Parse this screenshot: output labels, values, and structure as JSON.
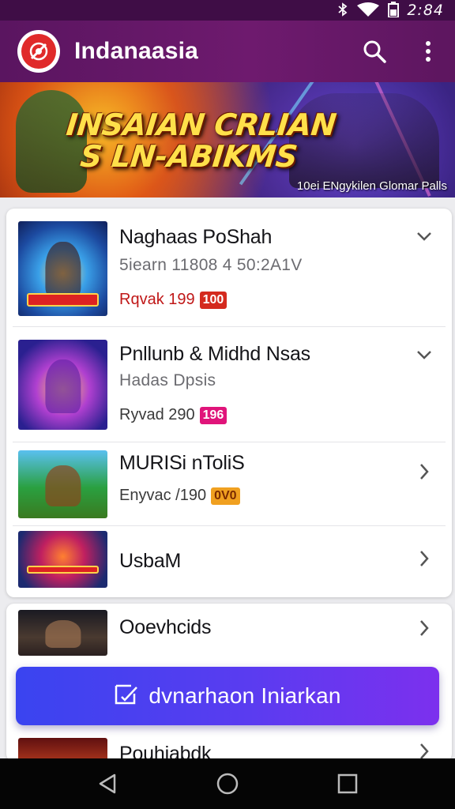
{
  "status_bar": {
    "time": "2:84",
    "icons": [
      "bluetooth-icon",
      "wifi-icon",
      "battery-icon"
    ]
  },
  "app_bar": {
    "title": "Indanaasia",
    "actions": [
      "search-icon",
      "more-vert-icon"
    ]
  },
  "banner": {
    "headline_line1": "INSAIAN CRLIAN",
    "headline_line2": "S LN-ABIKMS",
    "caption": "10ei ENgykilen Glomar Palls"
  },
  "list": {
    "items": [
      {
        "title": "Naghaas PoShah",
        "subtitle": "5iearn 11808 4 50:2A1V",
        "meta_text": "Rqvak 199",
        "badge": "100",
        "badge_color": "#d42a1e",
        "meta_color": "#c01818",
        "chevron": "chevron-down-icon"
      },
      {
        "title": "Pnllunb & Midhd Nsas",
        "subtitle": "Hadas Dpsis",
        "meta_text": "Ryvad 290",
        "badge": "196",
        "badge_color": "#e0147a",
        "meta_color": "#3a3a3a",
        "chevron": "chevron-down-icon"
      },
      {
        "title": "MURISi nToliS",
        "subtitle": "",
        "meta_text": "Enyvac /190",
        "badge": "0V0",
        "badge_color": "#f0a020",
        "meta_color": "#3a3a3a",
        "chevron": "chevron-right-icon"
      },
      {
        "title": "UsbaM",
        "subtitle": "",
        "meta_text": "",
        "badge": "",
        "chevron": "chevron-right-icon"
      },
      {
        "title": "Ooevhcids",
        "subtitle": "",
        "meta_text": "",
        "badge": "",
        "chevron": "chevron-right-icon"
      },
      {
        "title": "Pouhiabdk",
        "subtitle": "",
        "meta_text": "",
        "badge": "",
        "chevron": "chevron-right-icon"
      }
    ]
  },
  "cta": {
    "label": "dvnarhaon Iniarkan",
    "icon": "edit-note-icon"
  },
  "nav_bar": {
    "buttons": [
      "back-icon",
      "home-icon",
      "recents-icon"
    ]
  },
  "colors": {
    "app_bar": "#6a1a6c",
    "status_bar": "#3f0d46",
    "cta_start": "#3a44f0",
    "cta_end": "#7c30ee"
  }
}
